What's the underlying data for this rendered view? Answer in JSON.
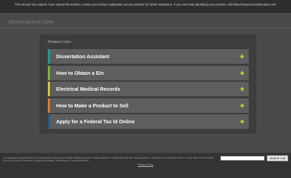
{
  "notice": {
    "text": "This domain has expired. If you owned this domain, contact your domain registration service provider for further assistance. If you need help identifying your provider, visit https://www.tucowsdomains.com/"
  },
  "site": {
    "title": "eltsempress.com"
  },
  "related": {
    "heading": "Related Links",
    "items": [
      {
        "label": "Dissertation Assistant",
        "accent": "#1a9f8f"
      },
      {
        "label": "How to Obtain a Ein",
        "accent": "#7fb33b"
      },
      {
        "label": "Electrical Medical Records",
        "accent": "#d6c93a"
      },
      {
        "label": "How to Make a Product to Sell",
        "accent": "#e07a2c"
      },
      {
        "label": "Apply for a Federal Tax Id Online",
        "accent": "#1f5d85"
      }
    ],
    "arrow_icon": "arrow-right-icon",
    "arrow_color": "#b8d438"
  },
  "footer": {
    "disclaimer": "This webpage was generated by the domain owner using Sedo Domain Parking. Disclaimer: Sedo maintains no relationship with third party advertisers. Reference to any specific service or trade mark is not controlled by Sedo nor does it constitute or imply its association, endorsement or recommendation.",
    "search_placeholder": "",
    "search_button": "Search Ads",
    "privacy_label": "Privacy Policy"
  }
}
